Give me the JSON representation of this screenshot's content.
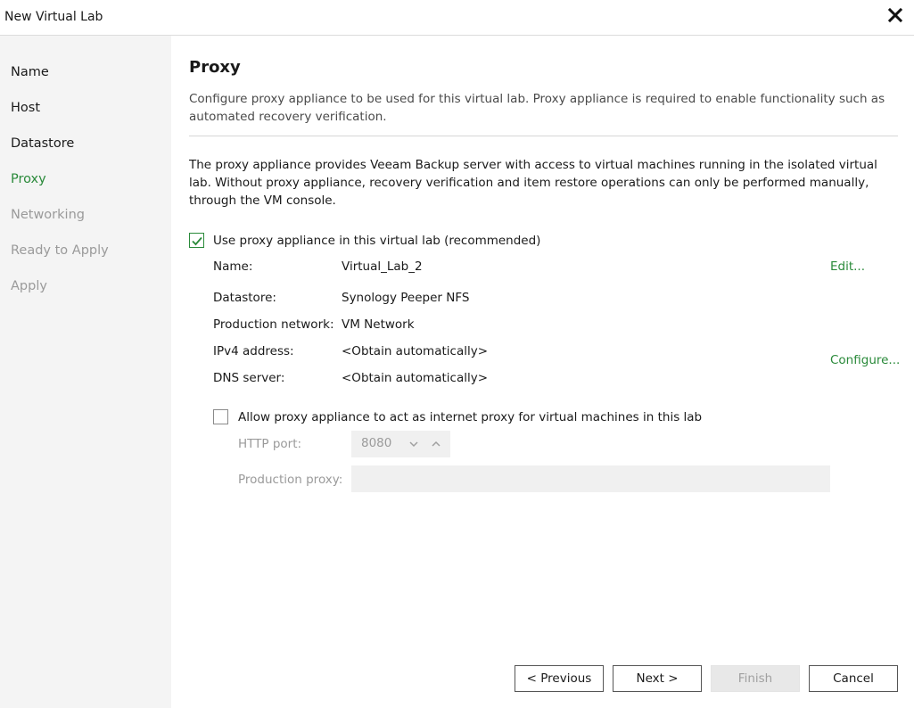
{
  "window": {
    "title": "New Virtual Lab"
  },
  "sidebar": {
    "steps": [
      {
        "label": "Name",
        "state": "done"
      },
      {
        "label": "Host",
        "state": "done"
      },
      {
        "label": "Datastore",
        "state": "done"
      },
      {
        "label": "Proxy",
        "state": "current"
      },
      {
        "label": "Networking",
        "state": "pending"
      },
      {
        "label": "Ready to Apply",
        "state": "pending"
      },
      {
        "label": "Apply",
        "state": "pending"
      }
    ]
  },
  "page": {
    "title": "Proxy",
    "description": "Configure proxy appliance to be used for this virtual lab. Proxy appliance is required to enable functionality such as automated recovery verification.",
    "body": "The proxy appliance provides Veeam Backup server with access to virtual machines running in the isolated virtual lab. Without proxy appliance, recovery verification and item restore operations can only be performed manually, through the VM console."
  },
  "proxy": {
    "use_label": "Use proxy appliance in this virtual lab (recommended)",
    "use_checked": true,
    "props": [
      {
        "label": "Name:",
        "value": "Virtual_Lab_2"
      },
      {
        "label": "Datastore:",
        "value": "Synology Peeper NFS"
      },
      {
        "label": "Production network:",
        "value": "VM Network"
      },
      {
        "label": "IPv4 address:",
        "value": "<Obtain automatically>"
      },
      {
        "label": "DNS server:",
        "value": "<Obtain automatically>"
      }
    ],
    "edit_link": "Edit...",
    "configure_link": "Configure..."
  },
  "internet_proxy": {
    "label": "Allow proxy appliance to act as internet proxy for virtual machines in this lab",
    "checked": false,
    "http_port_label": "HTTP port:",
    "http_port_value": "8080",
    "production_proxy_label": "Production proxy:",
    "production_proxy_value": ""
  },
  "buttons": {
    "previous": "< Previous",
    "next": "Next >",
    "finish": "Finish",
    "cancel": "Cancel"
  },
  "colors": {
    "accent": "#2a8a3a",
    "sidebar_bg": "#f4f4f4",
    "disabled_text": "#9a9a9a"
  },
  "icons": {
    "close": "close-icon",
    "check": "checkmark-icon",
    "spin_down": "chevron-down-icon",
    "spin_up": "chevron-up-icon"
  }
}
